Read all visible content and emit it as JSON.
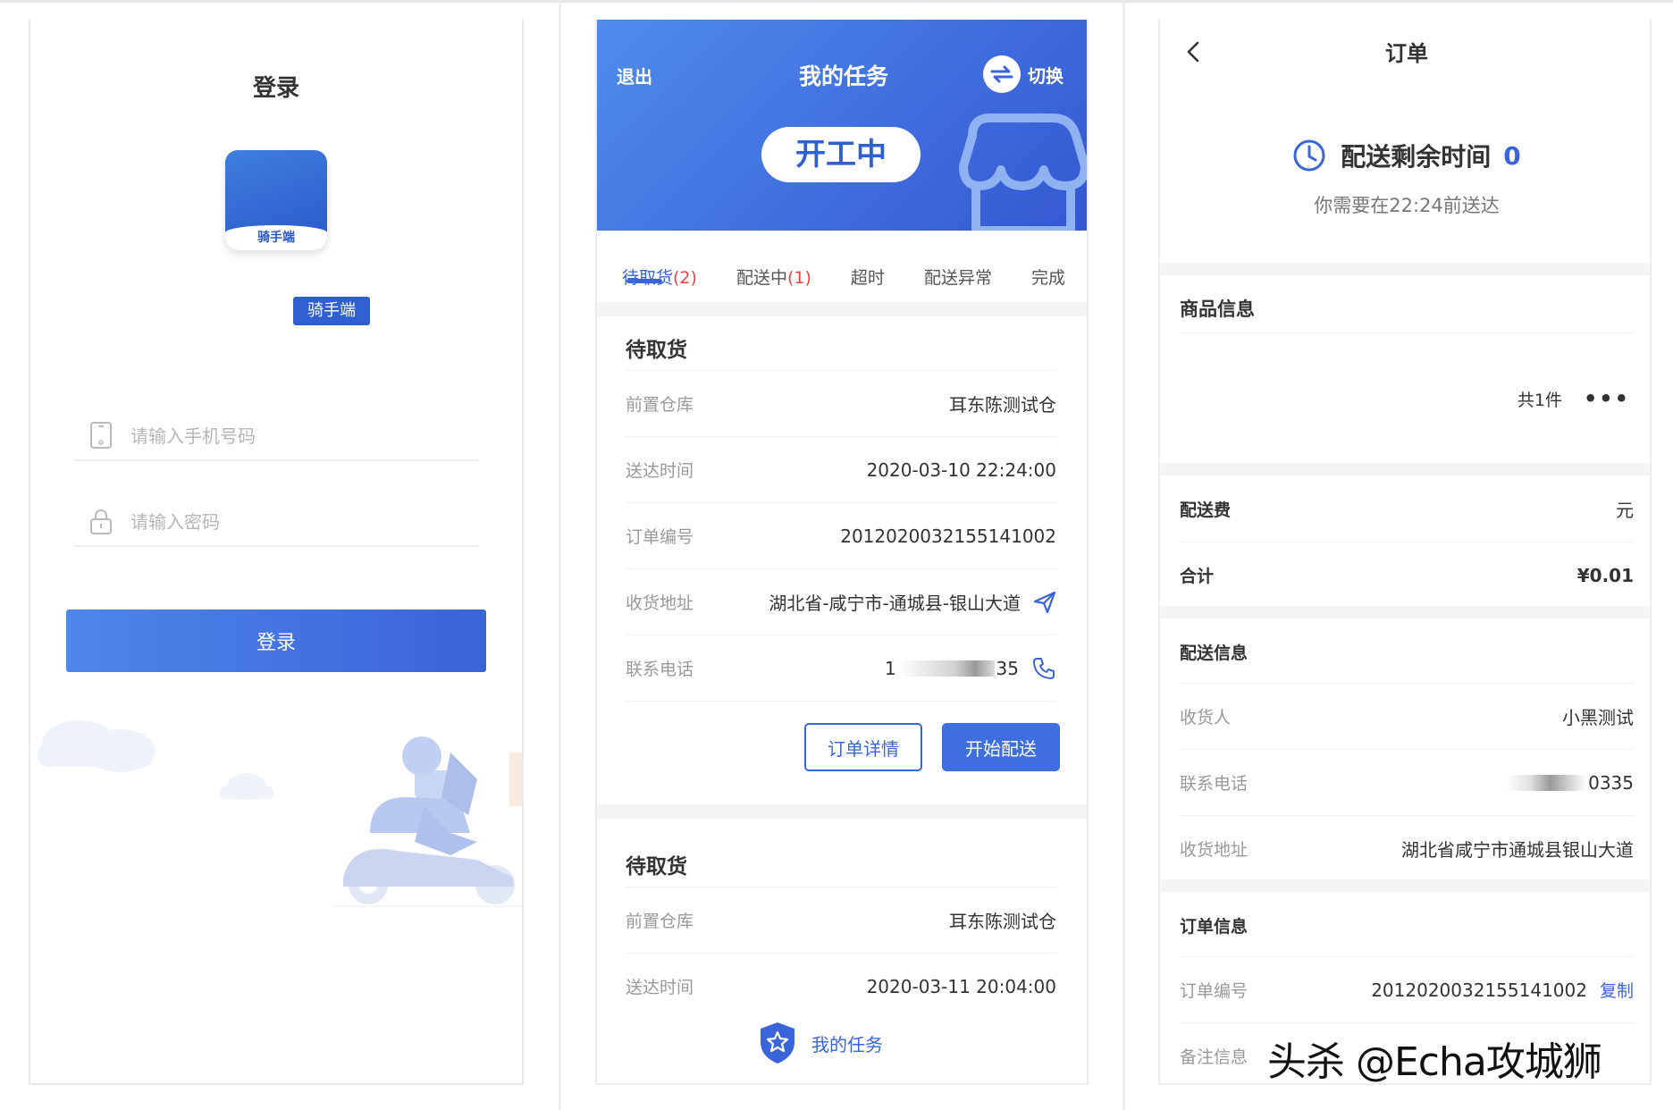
{
  "login": {
    "title": "登录",
    "logo_text": "骑手端",
    "badge": "骑手端",
    "phone_placeholder": "请输入手机号码",
    "password_placeholder": "请输入密码",
    "login_button": "登录"
  },
  "tasks": {
    "exit": "退出",
    "title": "我的任务",
    "switch": "切换",
    "status": "开工中",
    "tabs": [
      {
        "label": "待取货",
        "count": "(2)"
      },
      {
        "label": "配送中",
        "count": "(1)"
      },
      {
        "label": "超时",
        "count": ""
      },
      {
        "label": "配送异常",
        "count": ""
      },
      {
        "label": "完成",
        "count": ""
      }
    ],
    "card1": {
      "title": "待取货",
      "rows": [
        {
          "label": "前置仓库",
          "value": "耳东陈测试仓"
        },
        {
          "label": "送达时间",
          "value": "2020-03-10 22:24:00"
        },
        {
          "label": "订单编号",
          "value": "2012020032155141002"
        },
        {
          "label": "收货地址",
          "value": "湖北省-咸宁市-通城县-银山大道"
        },
        {
          "label": "联系电话",
          "value_prefix": "1",
          "value_suffix": "35"
        }
      ],
      "detail_button": "订单详情",
      "start_button": "开始配送"
    },
    "card2": {
      "title": "待取货",
      "rows": [
        {
          "label": "前置仓库",
          "value": "耳东陈测试仓"
        },
        {
          "label": "送达时间",
          "value": "2020-03-11 20:04:00"
        }
      ]
    },
    "bottom_nav": "我的任务"
  },
  "order": {
    "title": "订单",
    "remaining_label": "配送剩余时间",
    "remaining_value": "0",
    "deliver_before": "你需要在22:24前送达",
    "goods_section": "商品信息",
    "items_count": "共1件",
    "more": "•••",
    "fee_label": "配送费",
    "fee_value": "元",
    "total_label": "合计",
    "total_value": "¥0.01",
    "delivery_section": "配送信息",
    "receiver_label": "收货人",
    "receiver_value": "小黑测试",
    "phone_label": "联系电话",
    "phone_suffix": "0335",
    "address_label": "收货地址",
    "address_value": "湖北省咸宁市通城县银山大道",
    "order_section": "订单信息",
    "order_no_label": "订单编号",
    "order_no_value": "2012020032155141002",
    "copy": "复制",
    "remark_label": "备注信息"
  },
  "watermark": "头杀 @Echa攻城狮",
  "colors": {
    "primary": "#3a64d9",
    "header_start": "#4f8cec",
    "header_end": "#3457d2",
    "danger": "#e54545"
  }
}
